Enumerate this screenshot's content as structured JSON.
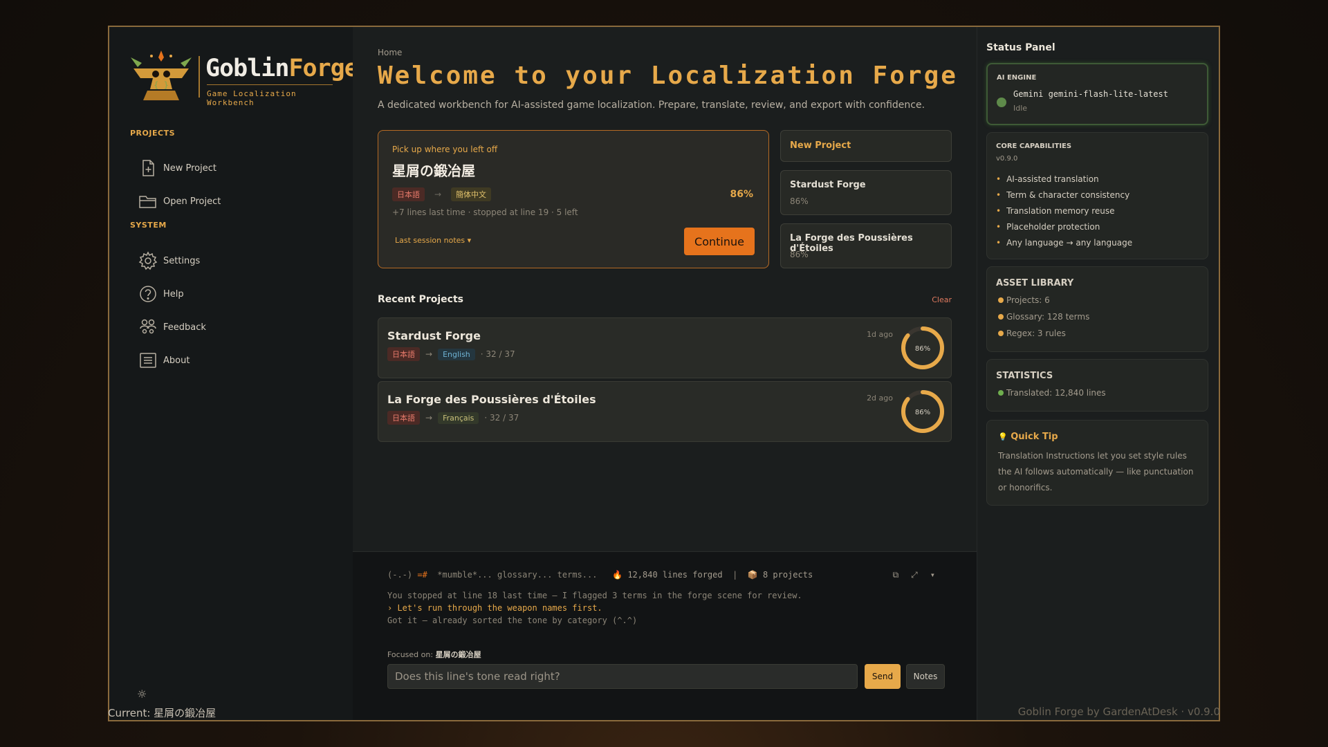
{
  "app": {
    "brand_part1": "Goblin",
    "brand_part2": "Forge",
    "tagline": "Game Localization Workbench"
  },
  "sidebar": {
    "projects_title": "PROJECTS",
    "system_title": "SYSTEM",
    "items": [
      {
        "label": "New Project",
        "icon": "new-file-icon"
      },
      {
        "label": "Open Project",
        "icon": "folder-icon"
      },
      {
        "label": "Settings",
        "icon": "gear-icon"
      },
      {
        "label": "Help",
        "icon": "question-icon"
      },
      {
        "label": "Feedback",
        "icon": "people-icon"
      },
      {
        "label": "About",
        "icon": "list-icon"
      }
    ],
    "theme_icon": "☼"
  },
  "main": {
    "breadcrumb": "Home",
    "title": "Welcome to your Localization Forge",
    "subtitle": "A dedicated workbench for AI-assisted game localization. Prepare, translate, review, and export with confidence.",
    "resume": {
      "label": "Pick up where you left off",
      "title": "星屑の鍛冶屋",
      "source_lang": "日本語",
      "arrow": "→",
      "target_lang": "簡体中文",
      "percent": "86%",
      "meta": "+7 lines last time  ·  stopped at line 19  ·  5 left",
      "notes": "Last session notes ▾",
      "continue": "Continue"
    },
    "quick": [
      {
        "title": "New Project",
        "pct": ""
      },
      {
        "title": "Stardust Forge",
        "pct": "86%"
      },
      {
        "title": "La Forge des Poussières d'Étoiles",
        "pct": "86%"
      }
    ],
    "recent_title": "Recent Projects",
    "clear": "Clear",
    "recent": [
      {
        "name": "Stardust Forge",
        "src": "日本語",
        "arrow": "→",
        "tgt": "English",
        "count": "· 32 / 37",
        "ago": "1d ago",
        "pct": "86%",
        "progress": 0.86
      },
      {
        "name": "La Forge des Poussières d'Étoiles",
        "src": "日本語",
        "arrow": "→",
        "tgt": "Français",
        "count": "· 32 / 37",
        "ago": "2d ago",
        "pct": "86%",
        "progress": 0.86
      }
    ]
  },
  "console": {
    "face": "(-.-)",
    "spark": "=#",
    "mumble": "*mumble*... glossary... terms...",
    "fire_icon": "🔥",
    "lines_forged": "12,840 lines forged",
    "sep": "|",
    "box_icon": "📦",
    "projects": "8 projects",
    "line1": "You stopped at line 18 last time — I flagged 3 terms in the forge scene for review.",
    "line2": "› Let's run through the weapon names first.",
    "line3": "Got it — already sorted the tone by category (^.^)",
    "focus_label": "Focused on:",
    "focus_value": "星屑の鍛冶屋",
    "input_placeholder": "Does this line's tone read right?",
    "send": "Send",
    "notes": "Notes"
  },
  "status": {
    "title": "Status Panel",
    "engine_label": "AI ENGINE",
    "engine_name": "Gemini gemini-flash-lite-latest",
    "engine_state": "Idle",
    "caps_title": "CORE CAPABILITIES",
    "version": "v0.9.0",
    "caps": [
      "AI-assisted translation",
      "Term & character consistency",
      "Translation memory reuse",
      "Placeholder protection",
      "Any language → any language"
    ],
    "library_title": "ASSET LIBRARY",
    "library": [
      "Projects: 6",
      "Glossary: 128 terms",
      "Regex: 3 rules"
    ],
    "stats_title": "STATISTICS",
    "stats": [
      "Translated: 12,840 lines"
    ],
    "tip_icon": "💡",
    "tip_title": "Quick Tip",
    "tip_text": "Translation Instructions let you set style rules the AI follows automatically — like punctuation or honorifics."
  },
  "footer": {
    "current": "Current: 星屑の鍛冶屋",
    "credit": "Goblin Forge by GardenAtDesk · v0.9.0"
  },
  "colors": {
    "accent": "#e7a94a",
    "primary_button": "#e6731c",
    "engine_dot": "#5e8a4a"
  }
}
